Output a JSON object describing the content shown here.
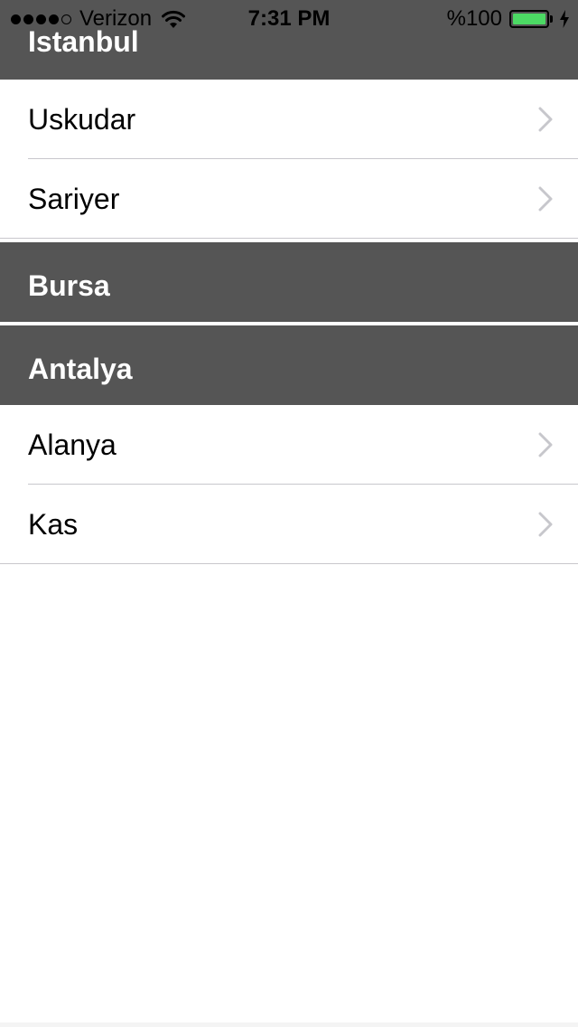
{
  "status_bar": {
    "carrier": "Verizon",
    "signal_bars_filled": 4,
    "signal_bars_total": 5,
    "time": "7:31 PM",
    "battery_text": "%100",
    "battery_level": 1.0,
    "battery_color": "#4cd964",
    "charging": true
  },
  "sections": [
    {
      "title": "Istanbul",
      "rows": [
        "Uskudar",
        "Sariyer"
      ]
    },
    {
      "title": "Bursa",
      "rows": []
    },
    {
      "title": "Antalya",
      "rows": [
        "Alanya",
        "Kas"
      ]
    }
  ],
  "colors": {
    "header_background": "#555555",
    "header_text": "#ffffff",
    "separator": "#c8c7cc",
    "chevron": "#c7c7cc"
  },
  "icons": {
    "row_accessory": "chevron-right-icon",
    "wifi": "wifi-icon",
    "battery": "battery-icon",
    "charging": "bolt-icon"
  }
}
